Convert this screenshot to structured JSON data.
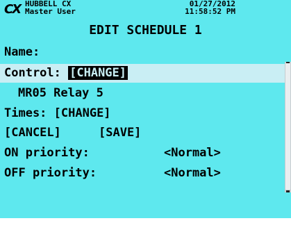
{
  "header": {
    "logo": "CX",
    "company": "HUBBELL CX",
    "user": "Master User",
    "date": "01/27/2012",
    "time": "11:58:52 PM"
  },
  "screen": {
    "title": "EDIT SCHEDULE 1",
    "name_label": "Name:",
    "control_label": "Control: ",
    "control_action": "[CHANGE]",
    "relay_name": "MR05 Relay 5",
    "times_label": "Times: ",
    "times_action": "[CHANGE]",
    "cancel": "[CANCEL]",
    "save": "[SAVE]",
    "on_priority_label": "ON priority:",
    "on_priority_value": "<Normal>",
    "off_priority_label": "OFF priority:",
    "off_priority_value": "<Normal>"
  },
  "colors": {
    "background": "#5ee8ee",
    "selected_row": "#c9eef4",
    "text": "#000000"
  }
}
